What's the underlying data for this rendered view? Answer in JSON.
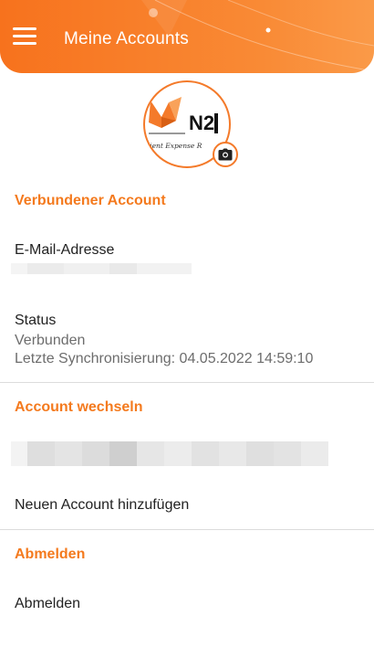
{
  "header": {
    "title": "Meine Accounts"
  },
  "avatar": {
    "logo_text": "N2",
    "tagline": "cient Expense R"
  },
  "connected": {
    "section_title": "Verbundener Account",
    "email_label": "E-Mail-Adresse",
    "status_label": "Status",
    "status_value": "Verbunden",
    "last_sync": "Letzte Synchronisierung: 04.05.2022 14:59:10"
  },
  "switch_account": {
    "section_title": "Account wechseln",
    "add_account": "Neuen Account hinzufügen"
  },
  "logout": {
    "section_title": "Abmelden",
    "logout_label": "Abmelden"
  },
  "colors": {
    "accent": "#f47a1e",
    "header": "#f7721d"
  },
  "icons": {
    "menu": "menu-icon",
    "camera": "camera-icon"
  }
}
